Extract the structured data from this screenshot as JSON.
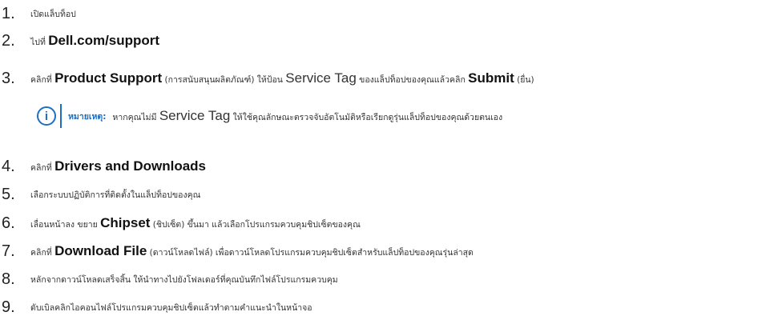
{
  "steps": [
    {
      "number": "1.",
      "parts": [
        {
          "text": "เปิดแล็บท็อป",
          "style": "normal"
        }
      ]
    },
    {
      "number": "2.",
      "parts": [
        {
          "text": "ไปที่ ",
          "style": "normal"
        },
        {
          "text": "Dell.com/support",
          "style": "bold"
        }
      ]
    },
    {
      "number": "3.",
      "parts": [
        {
          "text": "คลิกที่ ",
          "style": "normal"
        },
        {
          "text": "Product Support",
          "style": "bold"
        },
        {
          "text": " (การสนับสนุนผลิตภัณฑ์) ให้ป้อน ",
          "style": "normal"
        },
        {
          "text": "Service Tag",
          "style": "latin"
        },
        {
          "text": " ของแล็ปท็อปของคุณแล้วคลิก ",
          "style": "normal"
        },
        {
          "text": "Submit",
          "style": "bold"
        },
        {
          "text": " (ยื่น)",
          "style": "normal"
        }
      ]
    },
    {
      "number": "4.",
      "parts": [
        {
          "text": "คลิกที่ ",
          "style": "normal"
        },
        {
          "text": "Drivers and Downloads",
          "style": "bold"
        }
      ]
    },
    {
      "number": "5.",
      "parts": [
        {
          "text": "เลือกระบบปฏิบัติการที่ติดตั้งในแล็ปท็อปของคุณ",
          "style": "normal"
        }
      ]
    },
    {
      "number": "6.",
      "parts": [
        {
          "text": "เลื่อนหน้าลง ขยาย ",
          "style": "normal"
        },
        {
          "text": "Chipset",
          "style": "bold"
        },
        {
          "text": " (ชิปเซ็ต) ขึ้นมา แล้วเลือกโปรแกรมควบคุมชิปเซ็ตของคุณ",
          "style": "normal"
        }
      ]
    },
    {
      "number": "7.",
      "parts": [
        {
          "text": "คลิกที่ ",
          "style": "normal"
        },
        {
          "text": "Download File",
          "style": "bold"
        },
        {
          "text": " (ดาวน์โหลดไฟล์) เพื่อดาวน์โหลดโปรแกรมควบคุมชิปเซ็ตสำหรับแล็ปท็อปของคุณรุ่นล่าสุด",
          "style": "normal"
        }
      ]
    },
    {
      "number": "8.",
      "parts": [
        {
          "text": "หลักจากดาวน์โหลดเสร็จสิ้น ให้นำทางไปยังโฟลเดอร์ที่คุณบันทึกไฟล์โปรแกรมควบคุม",
          "style": "normal"
        }
      ]
    },
    {
      "number": "9.",
      "parts": [
        {
          "text": "ดับเบิลคลิกไอคอนไฟล์โปรแกรมควบคุมชิปเซ็ตแล้วทำตามคำแนะนำในหน้าจอ",
          "style": "normal"
        }
      ]
    }
  ],
  "note": {
    "icon": "info-icon",
    "icon_glyph": "i",
    "label": "หมายเหตุ:",
    "parts": [
      {
        "text": "หากคุณไม่มี ",
        "style": "normal"
      },
      {
        "text": "Service Tag",
        "style": "latin"
      },
      {
        "text": " ให้ใช้คุณลักษณะตรวจจับอัตโนมัติหรือเรียกดูรุ่นแล็ปท็อปของคุณด้วยตนเอง",
        "style": "normal"
      }
    ],
    "accent_color": "#1e6fc2"
  }
}
